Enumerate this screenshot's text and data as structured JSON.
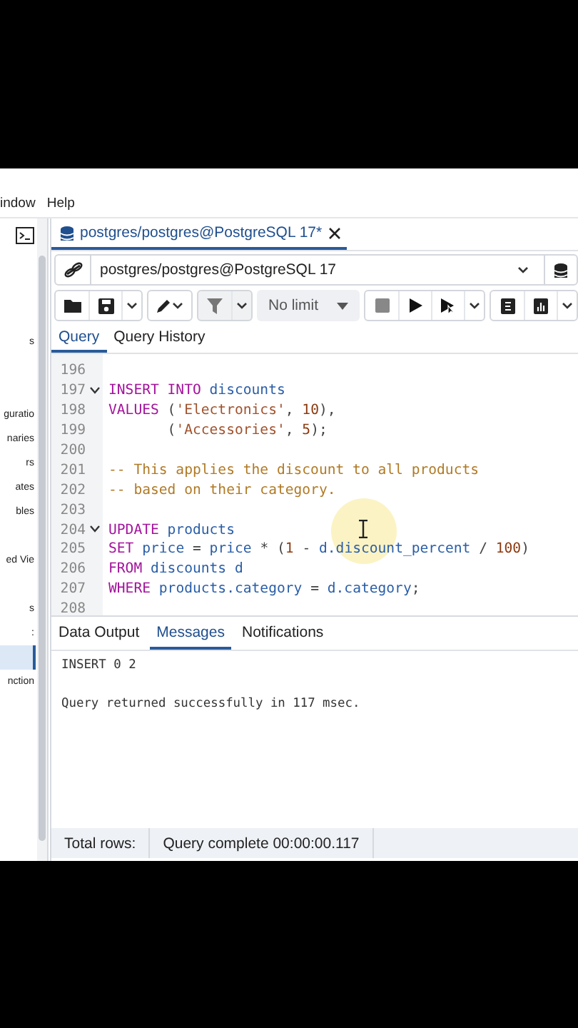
{
  "menu": [
    {
      "label": "indow"
    },
    {
      "label": "Help"
    }
  ],
  "sidebar": {
    "items": [
      {
        "label": "s",
        "selected": false
      },
      {
        "selected": false
      },
      {
        "selected": false
      },
      {
        "label": "guratio",
        "selected": false
      },
      {
        "label": "naries",
        "selected": false
      },
      {
        "label": "rs",
        "selected": false
      },
      {
        "label": "ates",
        "selected": false
      },
      {
        "label": "bles",
        "selected": false
      },
      {
        "selected": false
      },
      {
        "label": "ed Vie",
        "selected": false
      },
      {
        "selected": false
      },
      {
        "label": "s",
        "selected": false
      },
      {
        "label": ":",
        "selected": false
      },
      {
        "selected": true
      },
      {
        "label": "nction",
        "selected": false
      }
    ]
  },
  "document_tab": {
    "title": "postgres/postgres@PostgreSQL 17*",
    "selected": true
  },
  "connection": {
    "value": "postgres/postgres@PostgreSQL 17"
  },
  "toolbar": {
    "row_limit": "No limit"
  },
  "editor_tabs": [
    {
      "label": "Query",
      "selected": true
    },
    {
      "label": "Query History",
      "selected": false
    }
  ],
  "editor": {
    "lines": [
      {
        "number": "196",
        "fold": false
      },
      {
        "number": "197",
        "fold": true,
        "tokens": [
          {
            "kind": "keyword",
            "text": "INSERT INTO"
          },
          {
            "kind": "identifier",
            "text": " discounts"
          }
        ]
      },
      {
        "number": "198",
        "fold": false,
        "tokens": [
          {
            "kind": "keyword",
            "text": "VALUES"
          },
          {
            "kind": "plain",
            "text": " ("
          },
          {
            "kind": "string",
            "text": "'Electronics'"
          },
          {
            "kind": "plain",
            "text": ", "
          },
          {
            "kind": "number",
            "text": "10"
          },
          {
            "kind": "plain",
            "text": "),"
          }
        ]
      },
      {
        "number": "199",
        "fold": false,
        "tokens": [
          {
            "kind": "plain",
            "text": "       ("
          },
          {
            "kind": "string",
            "text": "'Accessories'"
          },
          {
            "kind": "plain",
            "text": ", "
          },
          {
            "kind": "number",
            "text": "5"
          },
          {
            "kind": "plain",
            "text": ");"
          }
        ]
      },
      {
        "number": "200",
        "fold": false
      },
      {
        "number": "201",
        "fold": false,
        "tokens": [
          {
            "kind": "comment",
            "text": "-- This applies the discount to all products"
          }
        ]
      },
      {
        "number": "202",
        "fold": false,
        "tokens": [
          {
            "kind": "comment",
            "text": "-- based on their category."
          }
        ]
      },
      {
        "number": "203",
        "fold": false
      },
      {
        "number": "204",
        "fold": true,
        "tokens": [
          {
            "kind": "keyword",
            "text": "UPDATE"
          },
          {
            "kind": "identifier",
            "text": " products"
          }
        ]
      },
      {
        "number": "205",
        "fold": false,
        "tokens": [
          {
            "kind": "keyword",
            "text": "SET"
          },
          {
            "kind": "identifier",
            "text": " price"
          },
          {
            "kind": "plain",
            "text": " = "
          },
          {
            "kind": "identifier",
            "text": "price"
          },
          {
            "kind": "plain",
            "text": " * ("
          },
          {
            "kind": "number",
            "text": "1"
          },
          {
            "kind": "plain",
            "text": " - "
          },
          {
            "kind": "identifier",
            "text": "d.discount_percent"
          },
          {
            "kind": "plain",
            "text": " / "
          },
          {
            "kind": "number",
            "text": "100"
          },
          {
            "kind": "plain",
            "text": ")"
          }
        ]
      },
      {
        "number": "206",
        "fold": false,
        "tokens": [
          {
            "kind": "keyword",
            "text": "FROM"
          },
          {
            "kind": "identifier",
            "text": " discounts d"
          }
        ]
      },
      {
        "number": "207",
        "fold": false,
        "tokens": [
          {
            "kind": "keyword",
            "text": "WHERE"
          },
          {
            "kind": "identifier",
            "text": " products.category"
          },
          {
            "kind": "plain",
            "text": " = "
          },
          {
            "kind": "identifier",
            "text": "d.category"
          },
          {
            "kind": "plain",
            "text": ";"
          }
        ]
      },
      {
        "number": "208",
        "fold": false
      }
    ]
  },
  "output_tabs": [
    {
      "label": "Data Output",
      "selected": false
    },
    {
      "label": "Messages",
      "selected": true
    },
    {
      "label": "Notifications",
      "selected": false
    }
  ],
  "messages": [
    {
      "text": "INSERT 0 2"
    },
    {
      "text": "Query returned successfully in 117 msec."
    }
  ],
  "status_bar": {
    "total_rows": "Total rows:",
    "status": "Query complete 00:00:00.117"
  }
}
